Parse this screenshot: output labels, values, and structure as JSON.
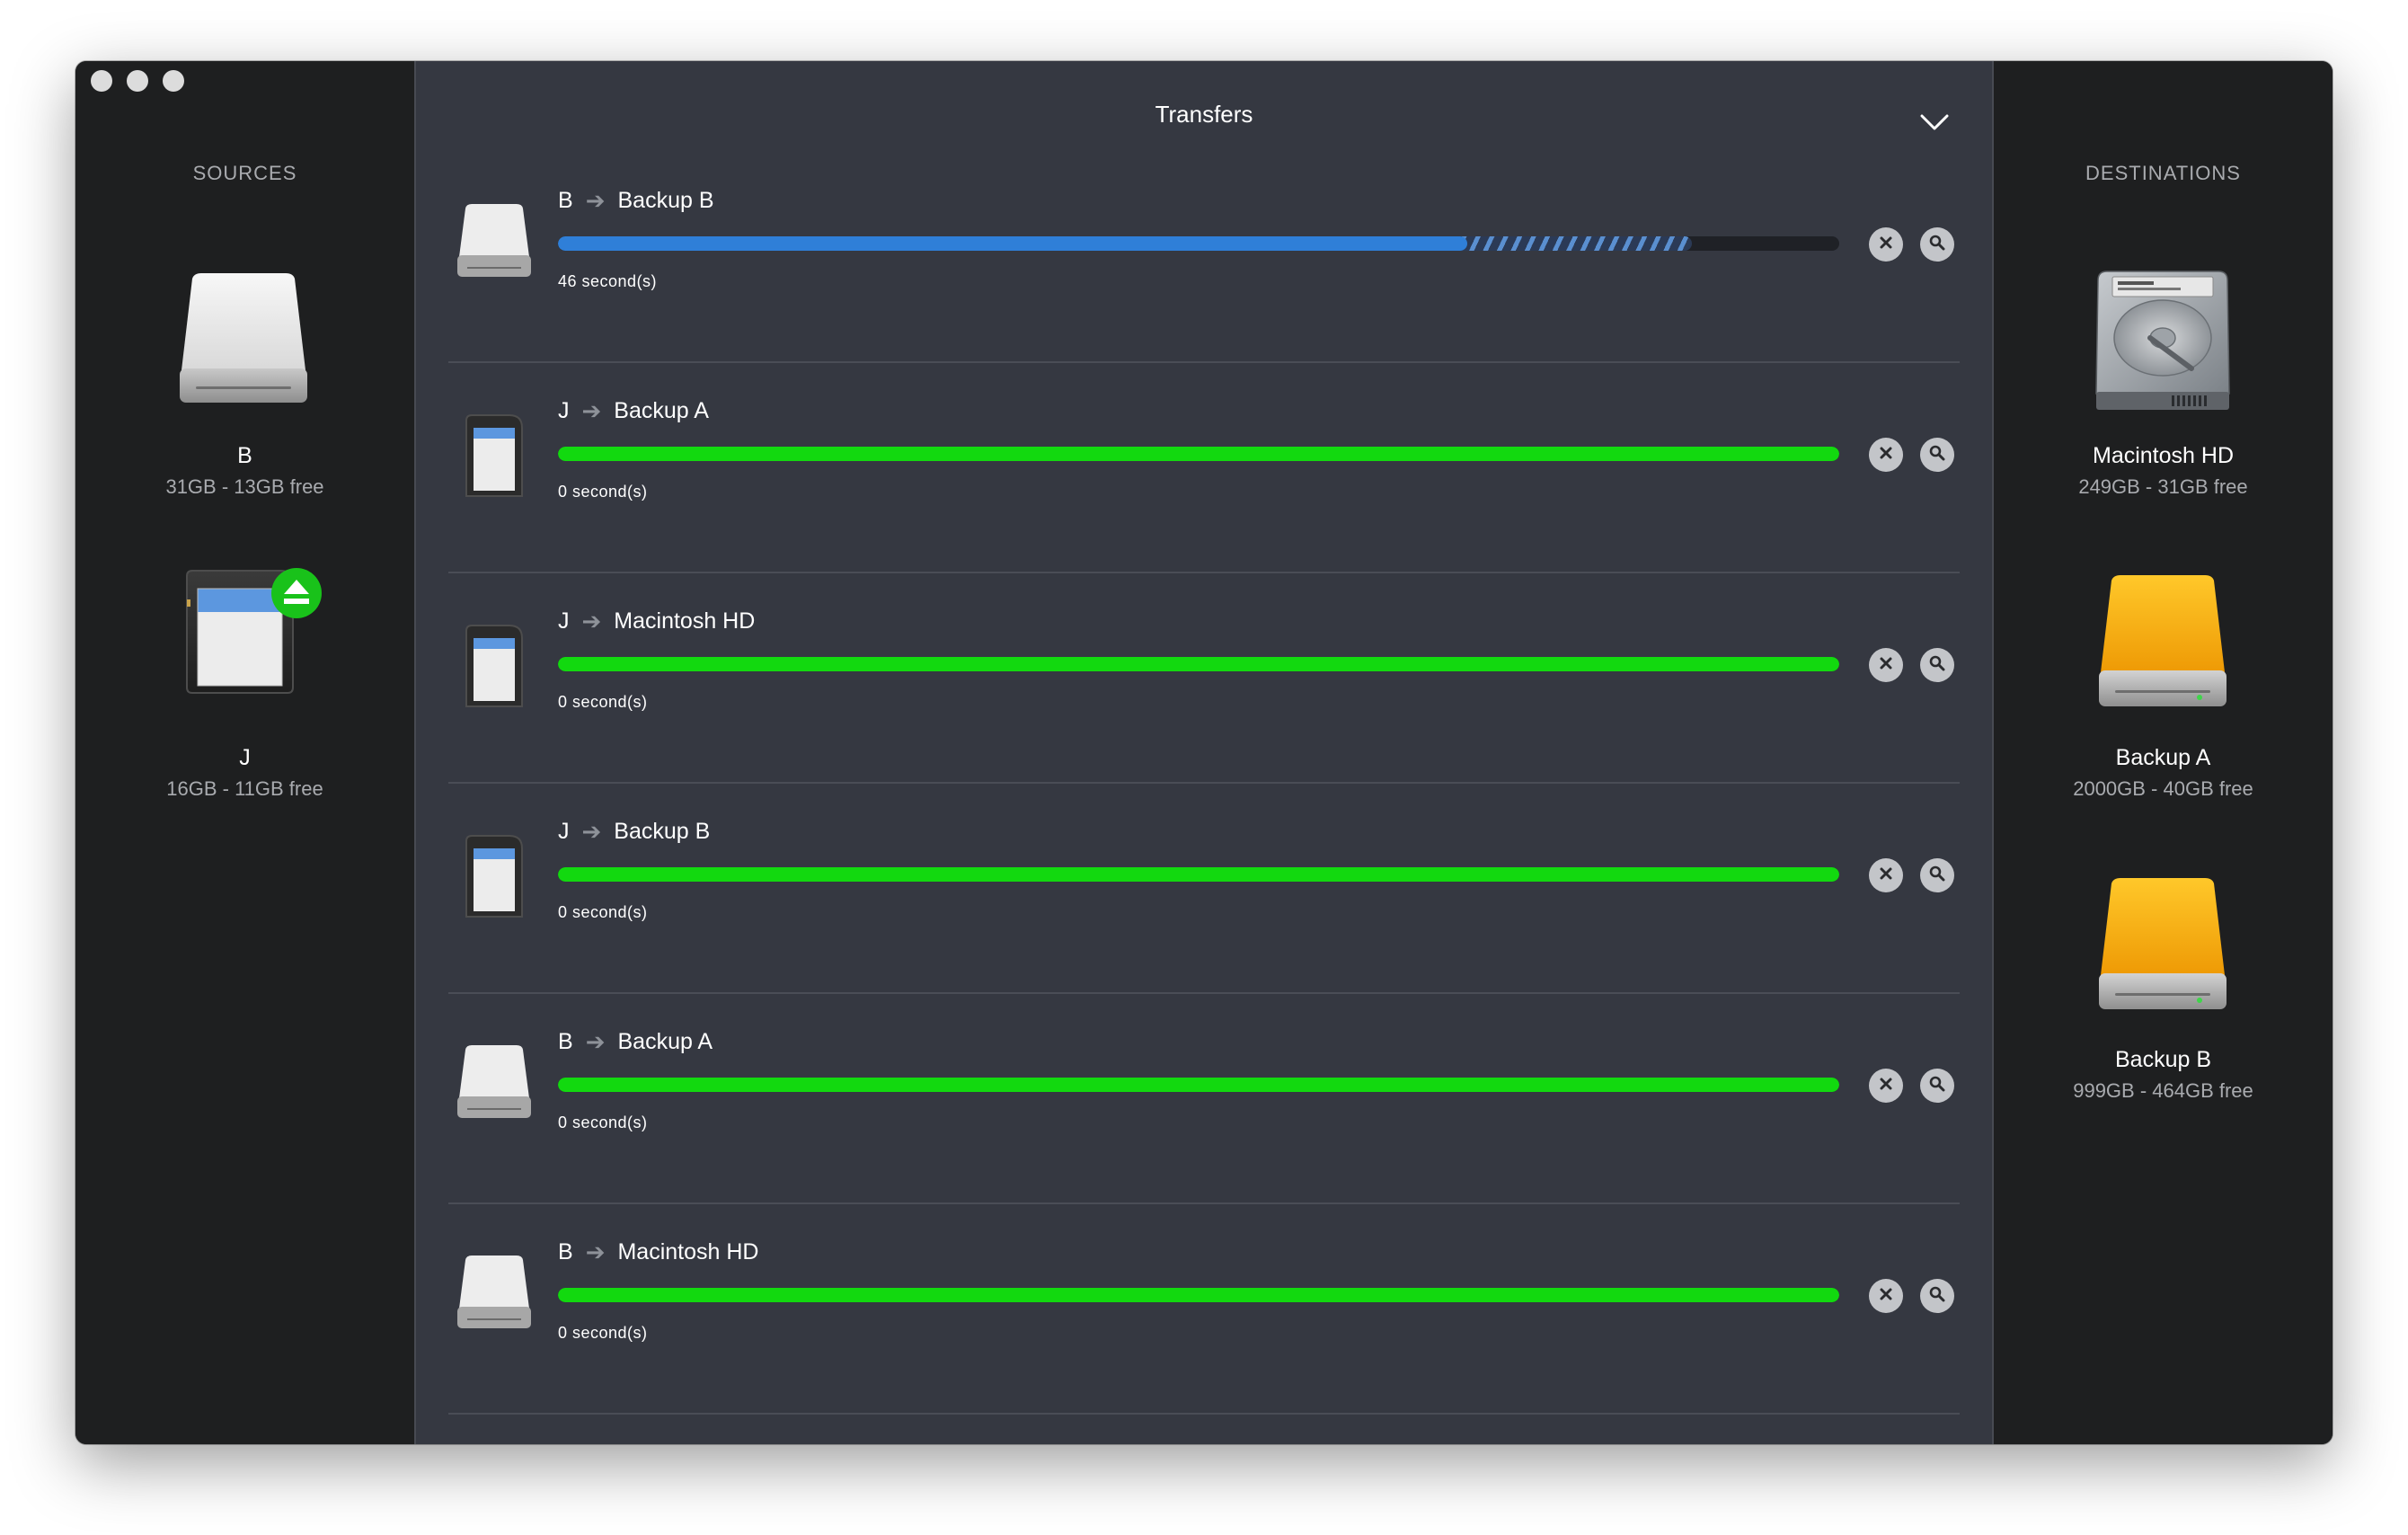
{
  "main": {
    "title": "Transfers"
  },
  "sources": {
    "title": "SOURCES",
    "drives": [
      {
        "name": "B",
        "size": "31GB - 13GB free",
        "icon": "external-drive-icon"
      },
      {
        "name": "J",
        "size": "16GB - 11GB free",
        "icon": "sd-card-icon",
        "badge": "eject-icon"
      }
    ]
  },
  "destinations": {
    "title": "DESTINATIONS",
    "drives": [
      {
        "name": "Macintosh HD",
        "size": "249GB - 31GB free",
        "icon": "internal-hard-drive-icon"
      },
      {
        "name": "Backup A",
        "size": "2000GB - 40GB free",
        "icon": "orange-external-drive-icon"
      },
      {
        "name": "Backup B",
        "size": "999GB - 464GB free",
        "icon": "orange-external-drive-icon"
      }
    ]
  },
  "transfers": [
    {
      "source": "B",
      "destination": "Backup B",
      "time": "46 second(s)",
      "progress": 0.71,
      "verify_progress": 0.885,
      "state": "in-progress",
      "icon": "external-drive-icon"
    },
    {
      "source": "J",
      "destination": "Backup A",
      "time": "0 second(s)",
      "progress": 1.0,
      "state": "complete",
      "icon": "sd-card-icon"
    },
    {
      "source": "J",
      "destination": "Macintosh HD",
      "time": "0 second(s)",
      "progress": 1.0,
      "state": "complete",
      "icon": "sd-card-icon"
    },
    {
      "source": "J",
      "destination": "Backup B",
      "time": "0 second(s)",
      "progress": 1.0,
      "state": "complete",
      "icon": "sd-card-icon"
    },
    {
      "source": "B",
      "destination": "Backup A",
      "time": "0 second(s)",
      "progress": 1.0,
      "state": "complete",
      "icon": "external-drive-icon"
    },
    {
      "source": "B",
      "destination": "Macintosh HD",
      "time": "0 second(s)",
      "progress": 1.0,
      "state": "complete",
      "icon": "external-drive-icon"
    }
  ],
  "colors": {
    "complete": "#12d90f",
    "in_progress": "#2f7fd8",
    "panel": "#353841",
    "sidebar": "#1e1f20",
    "eject_badge": "#19c21a",
    "orange_drive": "#f3a20c"
  }
}
